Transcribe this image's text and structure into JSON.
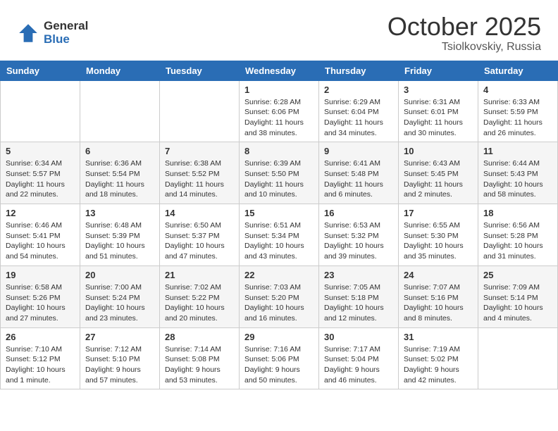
{
  "header": {
    "logo_general": "General",
    "logo_blue": "Blue",
    "title": "October 2025",
    "subtitle": "Tsiolkovskiy, Russia"
  },
  "days_of_week": [
    "Sunday",
    "Monday",
    "Tuesday",
    "Wednesday",
    "Thursday",
    "Friday",
    "Saturday"
  ],
  "weeks": [
    [
      {
        "day": "",
        "info": ""
      },
      {
        "day": "",
        "info": ""
      },
      {
        "day": "",
        "info": ""
      },
      {
        "day": "1",
        "info": "Sunrise: 6:28 AM\nSunset: 6:06 PM\nDaylight: 11 hours and 38 minutes."
      },
      {
        "day": "2",
        "info": "Sunrise: 6:29 AM\nSunset: 6:04 PM\nDaylight: 11 hours and 34 minutes."
      },
      {
        "day": "3",
        "info": "Sunrise: 6:31 AM\nSunset: 6:01 PM\nDaylight: 11 hours and 30 minutes."
      },
      {
        "day": "4",
        "info": "Sunrise: 6:33 AM\nSunset: 5:59 PM\nDaylight: 11 hours and 26 minutes."
      }
    ],
    [
      {
        "day": "5",
        "info": "Sunrise: 6:34 AM\nSunset: 5:57 PM\nDaylight: 11 hours and 22 minutes."
      },
      {
        "day": "6",
        "info": "Sunrise: 6:36 AM\nSunset: 5:54 PM\nDaylight: 11 hours and 18 minutes."
      },
      {
        "day": "7",
        "info": "Sunrise: 6:38 AM\nSunset: 5:52 PM\nDaylight: 11 hours and 14 minutes."
      },
      {
        "day": "8",
        "info": "Sunrise: 6:39 AM\nSunset: 5:50 PM\nDaylight: 11 hours and 10 minutes."
      },
      {
        "day": "9",
        "info": "Sunrise: 6:41 AM\nSunset: 5:48 PM\nDaylight: 11 hours and 6 minutes."
      },
      {
        "day": "10",
        "info": "Sunrise: 6:43 AM\nSunset: 5:45 PM\nDaylight: 11 hours and 2 minutes."
      },
      {
        "day": "11",
        "info": "Sunrise: 6:44 AM\nSunset: 5:43 PM\nDaylight: 10 hours and 58 minutes."
      }
    ],
    [
      {
        "day": "12",
        "info": "Sunrise: 6:46 AM\nSunset: 5:41 PM\nDaylight: 10 hours and 54 minutes."
      },
      {
        "day": "13",
        "info": "Sunrise: 6:48 AM\nSunset: 5:39 PM\nDaylight: 10 hours and 51 minutes."
      },
      {
        "day": "14",
        "info": "Sunrise: 6:50 AM\nSunset: 5:37 PM\nDaylight: 10 hours and 47 minutes."
      },
      {
        "day": "15",
        "info": "Sunrise: 6:51 AM\nSunset: 5:34 PM\nDaylight: 10 hours and 43 minutes."
      },
      {
        "day": "16",
        "info": "Sunrise: 6:53 AM\nSunset: 5:32 PM\nDaylight: 10 hours and 39 minutes."
      },
      {
        "day": "17",
        "info": "Sunrise: 6:55 AM\nSunset: 5:30 PM\nDaylight: 10 hours and 35 minutes."
      },
      {
        "day": "18",
        "info": "Sunrise: 6:56 AM\nSunset: 5:28 PM\nDaylight: 10 hours and 31 minutes."
      }
    ],
    [
      {
        "day": "19",
        "info": "Sunrise: 6:58 AM\nSunset: 5:26 PM\nDaylight: 10 hours and 27 minutes."
      },
      {
        "day": "20",
        "info": "Sunrise: 7:00 AM\nSunset: 5:24 PM\nDaylight: 10 hours and 23 minutes."
      },
      {
        "day": "21",
        "info": "Sunrise: 7:02 AM\nSunset: 5:22 PM\nDaylight: 10 hours and 20 minutes."
      },
      {
        "day": "22",
        "info": "Sunrise: 7:03 AM\nSunset: 5:20 PM\nDaylight: 10 hours and 16 minutes."
      },
      {
        "day": "23",
        "info": "Sunrise: 7:05 AM\nSunset: 5:18 PM\nDaylight: 10 hours and 12 minutes."
      },
      {
        "day": "24",
        "info": "Sunrise: 7:07 AM\nSunset: 5:16 PM\nDaylight: 10 hours and 8 minutes."
      },
      {
        "day": "25",
        "info": "Sunrise: 7:09 AM\nSunset: 5:14 PM\nDaylight: 10 hours and 4 minutes."
      }
    ],
    [
      {
        "day": "26",
        "info": "Sunrise: 7:10 AM\nSunset: 5:12 PM\nDaylight: 10 hours and 1 minute."
      },
      {
        "day": "27",
        "info": "Sunrise: 7:12 AM\nSunset: 5:10 PM\nDaylight: 9 hours and 57 minutes."
      },
      {
        "day": "28",
        "info": "Sunrise: 7:14 AM\nSunset: 5:08 PM\nDaylight: 9 hours and 53 minutes."
      },
      {
        "day": "29",
        "info": "Sunrise: 7:16 AM\nSunset: 5:06 PM\nDaylight: 9 hours and 50 minutes."
      },
      {
        "day": "30",
        "info": "Sunrise: 7:17 AM\nSunset: 5:04 PM\nDaylight: 9 hours and 46 minutes."
      },
      {
        "day": "31",
        "info": "Sunrise: 7:19 AM\nSunset: 5:02 PM\nDaylight: 9 hours and 42 minutes."
      },
      {
        "day": "",
        "info": ""
      }
    ]
  ]
}
